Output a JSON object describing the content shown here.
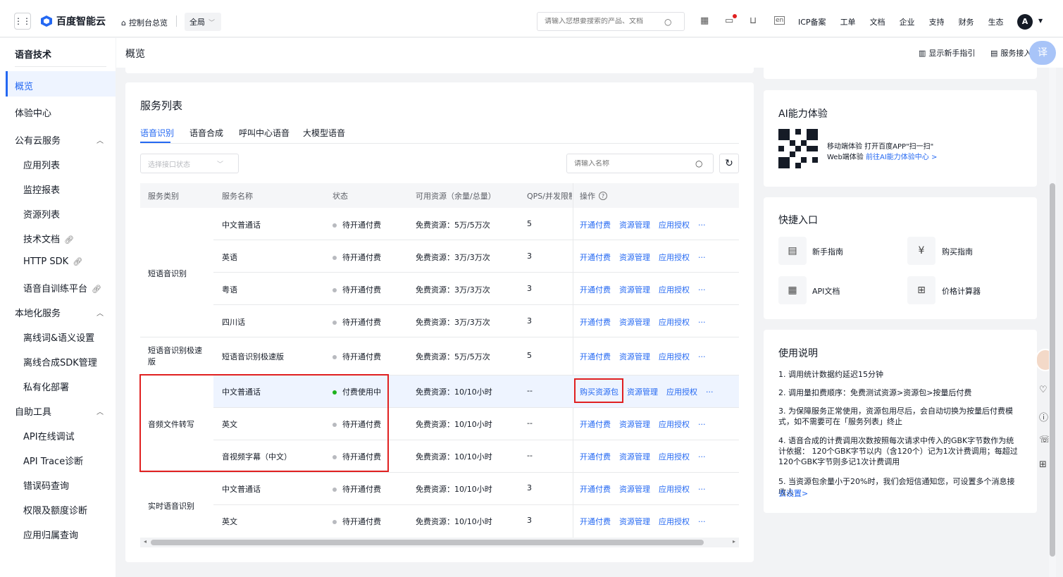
{
  "topbar": {
    "logo": "百度智能云",
    "console": "控制台总览",
    "region": "全局",
    "search_placeholder": "请输入您想要搜索的产品、文档",
    "nav": [
      "ICP备案",
      "工单",
      "文档",
      "企业",
      "支持",
      "财务",
      "生态"
    ],
    "avatar": "A"
  },
  "sidebar": {
    "title": "语音技术",
    "items": [
      {
        "label": "概览",
        "sub": false,
        "active": true
      },
      {
        "label": "体验中心",
        "sub": false
      },
      {
        "label": "公有云服务",
        "sub": false,
        "group": true
      },
      {
        "label": "应用列表",
        "sub": true
      },
      {
        "label": "监控报表",
        "sub": true
      },
      {
        "label": "资源列表",
        "sub": true
      },
      {
        "label": "技术文档",
        "sub": true,
        "link": true
      },
      {
        "label": "HTTP SDK",
        "sub": true,
        "link": true
      },
      {
        "label": "语音自训练平台",
        "sub": true,
        "link": true
      },
      {
        "label": "本地化服务",
        "sub": false,
        "group": true
      },
      {
        "label": "离线词&语义设置",
        "sub": true
      },
      {
        "label": "离线合成SDK管理",
        "sub": true
      },
      {
        "label": "私有化部署",
        "sub": true
      },
      {
        "label": "自助工具",
        "sub": false,
        "group": true
      },
      {
        "label": "API在线调试",
        "sub": true
      },
      {
        "label": "API Trace诊断",
        "sub": true
      },
      {
        "label": "错误码查询",
        "sub": true
      },
      {
        "label": "权限及额度诊断",
        "sub": true
      },
      {
        "label": "应用归属查询",
        "sub": true
      }
    ]
  },
  "header": {
    "title": "概览",
    "guide": "显示新手指引",
    "access": "服务接入指引"
  },
  "service": {
    "title": "服务列表",
    "tabs": [
      "语音识别",
      "语音合成",
      "呼叫中心语音",
      "大模型语音"
    ],
    "status_filter_placeholder": "选择接口状态",
    "name_search_placeholder": "请输入名称",
    "columns": [
      "服务类别",
      "服务名称",
      "状态",
      "可用资源（余量/总量）",
      "QPS/并发限制",
      "操作"
    ],
    "rows": [
      {
        "category": "短语音识别",
        "name": "中文普通话",
        "status": "待开通付费",
        "resource": "免费资源：5万/5万次",
        "qps": "5",
        "ops": [
          "开通付费",
          "资源管理",
          "应用授权"
        ]
      },
      {
        "category": "",
        "name": "英语",
        "status": "待开通付费",
        "resource": "免费资源：3万/3万次",
        "qps": "3",
        "ops": [
          "开通付费",
          "资源管理",
          "应用授权"
        ]
      },
      {
        "category": "",
        "name": "粤语",
        "status": "待开通付费",
        "resource": "免费资源：3万/3万次",
        "qps": "3",
        "ops": [
          "开通付费",
          "资源管理",
          "应用授权"
        ]
      },
      {
        "category": "",
        "name": "四川话",
        "status": "待开通付费",
        "resource": "免费资源：3万/3万次",
        "qps": "3",
        "ops": [
          "开通付费",
          "资源管理",
          "应用授权"
        ]
      },
      {
        "category": "短语音识别极速版",
        "name": "短语音识别极速版",
        "status": "待开通付费",
        "resource": "免费资源：5万/5万次",
        "qps": "5",
        "ops": [
          "开通付费",
          "资源管理",
          "应用授权"
        ]
      },
      {
        "category": "音频文件转写",
        "name": "中文普通话",
        "status": "付费使用中",
        "resource": "免费资源：10/10小时",
        "qps": "--",
        "ops": [
          "购买资源包",
          "资源管理",
          "应用授权"
        ]
      },
      {
        "category": "",
        "name": "英文",
        "status": "待开通付费",
        "resource": "免费资源：10/10小时",
        "qps": "--",
        "ops": [
          "开通付费",
          "资源管理",
          "应用授权"
        ]
      },
      {
        "category": "",
        "name": "音视频字幕（中文）",
        "status": "待开通付费",
        "resource": "免费资源：10/10小时",
        "qps": "--",
        "ops": [
          "开通付费",
          "资源管理",
          "应用授权"
        ]
      },
      {
        "category": "实时语音识别",
        "name": "中文普通话",
        "status": "待开通付费",
        "resource": "免费资源：10/10小时",
        "qps": "3",
        "ops": [
          "开通付费",
          "资源管理",
          "应用授权"
        ]
      },
      {
        "category": "",
        "name": "英文",
        "status": "待开通付费",
        "resource": "免费资源：10/10小时",
        "qps": "3",
        "ops": [
          "开通付费",
          "资源管理",
          "应用授权"
        ]
      }
    ],
    "more": "···"
  },
  "ai": {
    "title": "AI能力体验",
    "mobile": "移动端体验 打开百度APP\"扫一扫\"",
    "web_label": "Web端体验",
    "web_link": "前往AI能力体验中心 >"
  },
  "quick": {
    "title": "快捷入口",
    "items": [
      "新手指南",
      "购买指南",
      "API文档",
      "价格计算器"
    ]
  },
  "usage": {
    "title": "使用说明",
    "notes": [
      "1. 调用统计数据约延迟15分钟",
      "2. 调用量扣费顺序：免费测试资源>资源包>按量后付费",
      "3. 为保障服务正常使用，资源包用尽后，会自动切换为按量后付费模式，如不需要可在「服务列表」终止",
      "4. 语音合成的计费调用次数按照每次请求中传入的GBK字节数作为统计依据： 120个GBK字节以内（含120个）记为1次计费调用；每超过120个GBK字节则多记1次计费调用",
      "5. 当资源包余量小于20%时，我们会短信通知您，可设置多个消息接收人"
    ],
    "link": "去设置>"
  },
  "colors": {
    "accent": "#2468f2",
    "highlight": "#e02020",
    "active_dot": "#1db21d"
  }
}
